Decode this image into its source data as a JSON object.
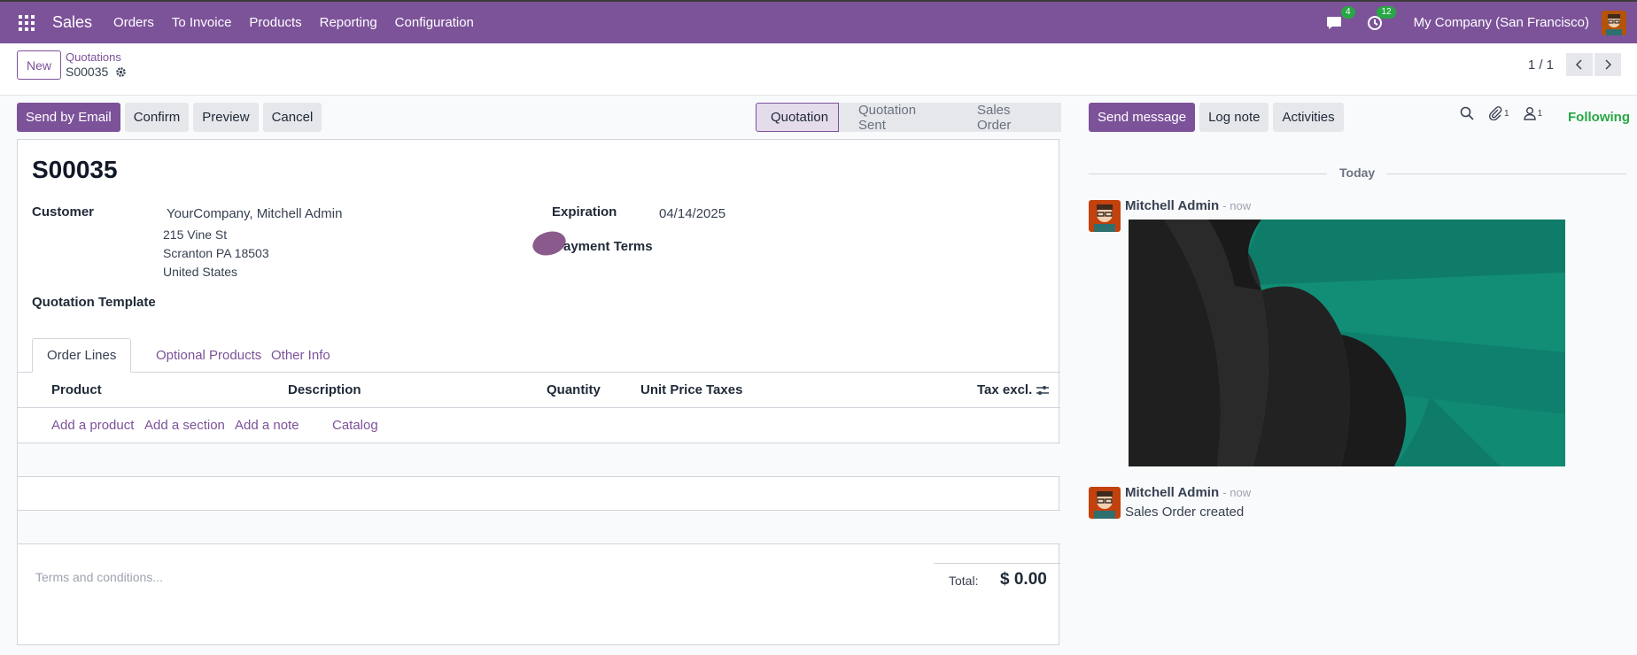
{
  "navbar": {
    "app_name": "Sales",
    "menu": [
      "Orders",
      "To Invoice",
      "Products",
      "Reporting",
      "Configuration"
    ],
    "messages_badge": "4",
    "activities_badge": "12",
    "company": "My Company (San Francisco)",
    "icons": [
      "apps-grid-icon",
      "chat-icon",
      "clock-icon",
      "user-avatar"
    ]
  },
  "control_panel": {
    "new_label": "New",
    "breadcrumb": "Quotations",
    "record_name": "S00035",
    "pager_value": "1 / 1"
  },
  "actions": {
    "send_by_email": "Send by Email",
    "confirm": "Confirm",
    "preview": "Preview",
    "cancel": "Cancel"
  },
  "stages": [
    "Quotation",
    "Quotation Sent",
    "Sales Order"
  ],
  "active_stage": "Quotation",
  "form": {
    "title": "S00035",
    "customer_label": "Customer",
    "customer_value": "YourCompany, Mitchell Admin",
    "address_line1": "215 Vine St",
    "address_line2": "Scranton PA 18503",
    "address_line3": "United States",
    "expiration_label": "Expiration",
    "expiration_value": "04/14/2025",
    "payment_terms_label": "ayment Terms",
    "template_label": "Quotation Template"
  },
  "tabs": [
    "Order Lines",
    "Optional Products",
    "Other Info"
  ],
  "order_lines": {
    "columns": [
      "Product",
      "Description",
      "Quantity",
      "Unit Price",
      "Taxes",
      "Tax excl."
    ],
    "add_product": "Add a product",
    "add_section": "Add a section",
    "add_note": "Add a note",
    "catalog": "Catalog"
  },
  "footer": {
    "terms_placeholder": "Terms and conditions...",
    "total_label": "Total:",
    "total_value": "$ 0.00"
  },
  "chatter": {
    "send_message": "Send message",
    "log_note": "Log note",
    "activities": "Activities",
    "attachments_count": "1",
    "followers_count": "1",
    "following": "Following",
    "today": "Today",
    "messages": [
      {
        "author": "Mitchell Admin",
        "time": "- now",
        "body": ""
      },
      {
        "author": "Mitchell Admin",
        "time": "- now",
        "body": "Sales Order created"
      }
    ]
  },
  "colors": {
    "brand": "#7c5299",
    "success": "#28a745",
    "image_teal": "#118a74"
  }
}
